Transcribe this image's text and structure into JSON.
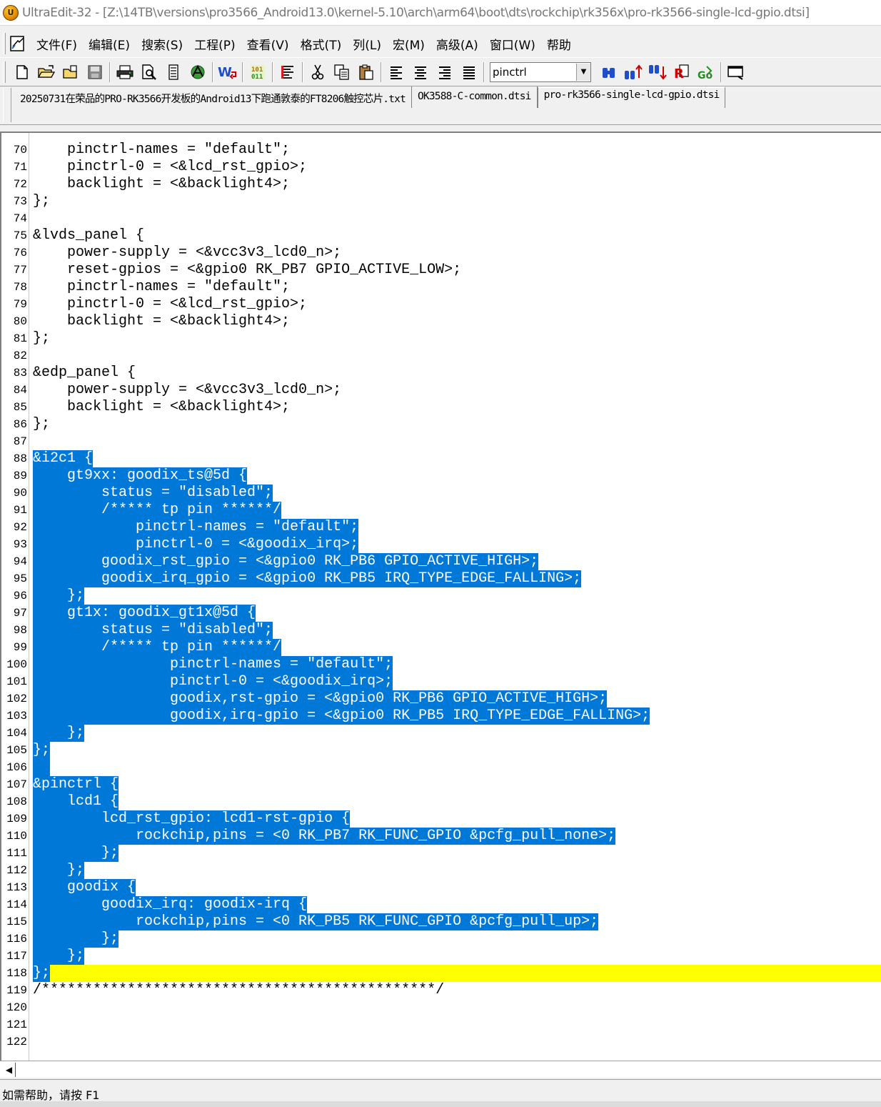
{
  "window": {
    "title": "UltraEdit-32 - [Z:\\14TB\\versions\\pro3566_Android13.0\\kernel-5.10\\arch\\arm64\\boot\\dts\\rockchip\\rk356x\\pro-rk3566-single-lcd-gpio.dtsi]"
  },
  "menu": {
    "items": [
      {
        "label": "文件(F)"
      },
      {
        "label": "编辑(E)"
      },
      {
        "label": "搜索(S)"
      },
      {
        "label": "工程(P)"
      },
      {
        "label": "查看(V)"
      },
      {
        "label": "格式(T)"
      },
      {
        "label": "列(L)"
      },
      {
        "label": "宏(M)"
      },
      {
        "label": "高级(A)"
      },
      {
        "label": "窗口(W)"
      },
      {
        "label": "帮助"
      }
    ]
  },
  "toolbar": {
    "search_value": "pinctrl",
    "buttons": [
      "new-file-icon",
      "open-file-icon",
      "open-recent-icon",
      "save-icon",
      "print-icon",
      "print-preview-icon",
      "file-list-icon",
      "ftp-icon",
      "word-wrap-icon",
      "hex-mode-icon",
      "column-mode-icon",
      "cut-icon",
      "copy-icon",
      "paste-icon",
      "align-left-icon",
      "align-center-icon",
      "align-right-icon",
      "justify-icon",
      "find-icon",
      "find-next-icon",
      "find-prev-icon",
      "replace-icon",
      "goto-icon",
      "window-icon"
    ]
  },
  "tabs": [
    {
      "label": "20250731在荣品的PRO-RK3566开发板的Android13下跑通敦泰的FT8206触控芯片.txt",
      "active": false
    },
    {
      "label": "OK3588-C-common.dtsi",
      "active": false
    },
    {
      "label": "pro-rk3566-single-lcd-gpio.dtsi",
      "active": true
    }
  ],
  "editor": {
    "current_line": "118",
    "lines": [
      {
        "n": "70",
        "text": "    pinctrl-names = \"default\";",
        "sel": false
      },
      {
        "n": "71",
        "text": "    pinctrl-0 = <&lcd_rst_gpio>;",
        "sel": false
      },
      {
        "n": "72",
        "text": "    backlight = <&backlight4>;",
        "sel": false
      },
      {
        "n": "73",
        "text": "};",
        "sel": false
      },
      {
        "n": "74",
        "text": "",
        "sel": false
      },
      {
        "n": "75",
        "text": "&lvds_panel {",
        "sel": false
      },
      {
        "n": "76",
        "text": "    power-supply = <&vcc3v3_lcd0_n>;",
        "sel": false
      },
      {
        "n": "77",
        "text": "    reset-gpios = <&gpio0 RK_PB7 GPIO_ACTIVE_LOW>;",
        "sel": false
      },
      {
        "n": "78",
        "text": "    pinctrl-names = \"default\";",
        "sel": false
      },
      {
        "n": "79",
        "text": "    pinctrl-0 = <&lcd_rst_gpio>;",
        "sel": false
      },
      {
        "n": "80",
        "text": "    backlight = <&backlight4>;",
        "sel": false
      },
      {
        "n": "81",
        "text": "};",
        "sel": false
      },
      {
        "n": "82",
        "text": "",
        "sel": false
      },
      {
        "n": "83",
        "text": "&edp_panel {",
        "sel": false
      },
      {
        "n": "84",
        "text": "    power-supply = <&vcc3v3_lcd0_n>;",
        "sel": false
      },
      {
        "n": "85",
        "text": "    backlight = <&backlight4>;",
        "sel": false
      },
      {
        "n": "86",
        "text": "};",
        "sel": false
      },
      {
        "n": "87",
        "text": "",
        "sel": false
      },
      {
        "n": "88",
        "text": "&i2c1 {",
        "sel": true
      },
      {
        "n": "89",
        "text": "    gt9xx: goodix_ts@5d {",
        "sel": true
      },
      {
        "n": "90",
        "text": "        status = \"disabled\";",
        "sel": true
      },
      {
        "n": "91",
        "text": "        /***** tp pin ******/",
        "sel": true
      },
      {
        "n": "92",
        "text": "            pinctrl-names = \"default\";",
        "sel": true
      },
      {
        "n": "93",
        "text": "            pinctrl-0 = <&goodix_irq>;",
        "sel": true
      },
      {
        "n": "94",
        "text": "        goodix_rst_gpio = <&gpio0 RK_PB6 GPIO_ACTIVE_HIGH>;",
        "sel": true
      },
      {
        "n": "95",
        "text": "        goodix_irq_gpio = <&gpio0 RK_PB5 IRQ_TYPE_EDGE_FALLING>;",
        "sel": true
      },
      {
        "n": "96",
        "text": "    };",
        "sel": true
      },
      {
        "n": "97",
        "text": "    gt1x: goodix_gt1x@5d {",
        "sel": true
      },
      {
        "n": "98",
        "text": "        status = \"disabled\";",
        "sel": true
      },
      {
        "n": "99",
        "text": "        /***** tp pin ******/",
        "sel": true
      },
      {
        "n": "100",
        "text": "                pinctrl-names = \"default\";",
        "sel": true
      },
      {
        "n": "101",
        "text": "                pinctrl-0 = <&goodix_irq>;",
        "sel": true
      },
      {
        "n": "102",
        "text": "                goodix,rst-gpio = <&gpio0 RK_PB6 GPIO_ACTIVE_HIGH>;",
        "sel": true
      },
      {
        "n": "103",
        "text": "                goodix,irq-gpio = <&gpio0 RK_PB5 IRQ_TYPE_EDGE_FALLING>;",
        "sel": true
      },
      {
        "n": "104",
        "text": "    };",
        "sel": true
      },
      {
        "n": "105",
        "text": "};",
        "sel": true
      },
      {
        "n": "106",
        "text": "",
        "sel": true
      },
      {
        "n": "107",
        "text": "&pinctrl {",
        "sel": true
      },
      {
        "n": "108",
        "text": "    lcd1 {",
        "sel": true
      },
      {
        "n": "109",
        "text": "        lcd_rst_gpio: lcd1-rst-gpio {",
        "sel": true
      },
      {
        "n": "110",
        "text": "            rockchip,pins = <0 RK_PB7 RK_FUNC_GPIO &pcfg_pull_none>;",
        "sel": true
      },
      {
        "n": "111",
        "text": "        };",
        "sel": true
      },
      {
        "n": "112",
        "text": "    };",
        "sel": true
      },
      {
        "n": "113",
        "text": "    goodix {",
        "sel": true
      },
      {
        "n": "114",
        "text": "        goodix_irq: goodix-irq {",
        "sel": true
      },
      {
        "n": "115",
        "text": "            rockchip,pins = <0 RK_PB5 RK_FUNC_GPIO &pcfg_pull_up>;",
        "sel": true
      },
      {
        "n": "116",
        "text": "        };",
        "sel": true
      },
      {
        "n": "117",
        "text": "    };",
        "sel": true
      },
      {
        "n": "118",
        "text": "};",
        "sel": true
      },
      {
        "n": "119",
        "text": "/**********************************************/",
        "sel": false
      },
      {
        "n": "120",
        "text": "",
        "sel": false
      },
      {
        "n": "121",
        "text": "",
        "sel": false
      },
      {
        "n": "122",
        "text": "",
        "sel": false
      }
    ]
  },
  "status": {
    "help_text": "如需帮助，请按 F1"
  },
  "colors": {
    "selection": "#0078d7",
    "current_line": "#ffff00"
  }
}
